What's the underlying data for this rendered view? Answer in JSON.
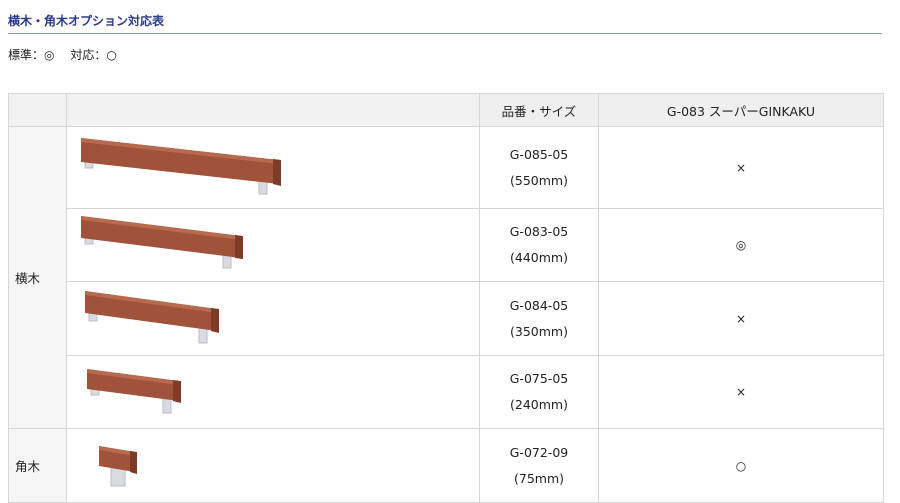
{
  "title": "横木・角木オプション対応表",
  "legend": {
    "standard": "標準：◎",
    "supported": "対応：○"
  },
  "table": {
    "header": {
      "col_size": "品番・サイズ",
      "col_model": "G-083 スーパーGINKAKU"
    },
    "categories": {
      "yokogi": "横木",
      "kakugi": "角木"
    },
    "rows": [
      {
        "code": "G-085-05",
        "size": "(550mm)",
        "mark": "×"
      },
      {
        "code": "G-083-05",
        "size": "(440mm)",
        "mark": "◎"
      },
      {
        "code": "G-084-05",
        "size": "(350mm)",
        "mark": "×"
      },
      {
        "code": "G-075-05",
        "size": "(240mm)",
        "mark": "×"
      },
      {
        "code": "G-072-09",
        "size": "(75mm)",
        "mark": "○"
      }
    ]
  },
  "colors": {
    "wood": "#a0523a",
    "wood_dark": "#7e3b28",
    "metal": "#d9dbe0",
    "heading": "#2b3a8a"
  }
}
